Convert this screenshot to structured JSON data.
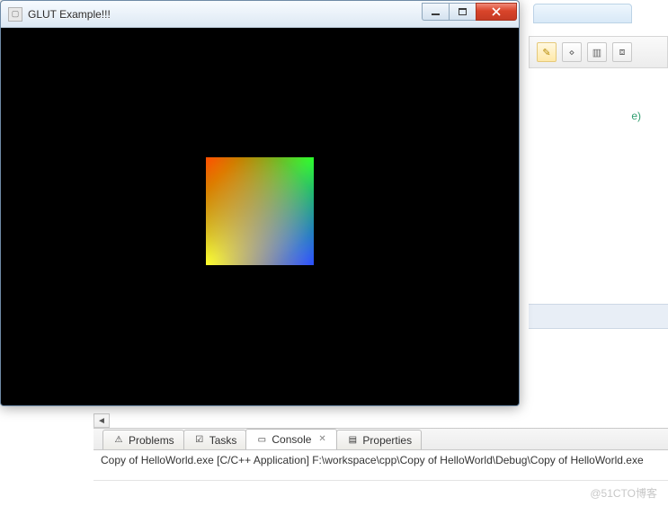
{
  "glut_window": {
    "title": "GLUT Example!!!",
    "icon_name": "app-icon",
    "buttons": {
      "minimize_name": "minimize-button",
      "maximize_name": "maximize-button",
      "close_name": "close-button"
    },
    "quad_vertex_colors": {
      "top_left": "#ff0000",
      "top_right": "#00ff00",
      "bottom_right": "#0000ff",
      "bottom_left": "#ffff00"
    }
  },
  "ide": {
    "toolbar_icons": [
      "edit-icon",
      "tag-icon",
      "columns-icon",
      "filter-icon"
    ],
    "hint_text": "e)"
  },
  "bottom_panel": {
    "tabs": [
      {
        "label": "Problems",
        "icon": "problems-icon"
      },
      {
        "label": "Tasks",
        "icon": "tasks-icon"
      },
      {
        "label": "Console",
        "icon": "console-icon",
        "active": true,
        "closable": true
      },
      {
        "label": "Properties",
        "icon": "properties-icon"
      }
    ],
    "console_line": "Copy of HelloWorld.exe [C/C++ Application] F:\\workspace\\cpp\\Copy of HelloWorld\\Debug\\Copy of HelloWorld.exe"
  },
  "watermark": "@51CTO博客"
}
